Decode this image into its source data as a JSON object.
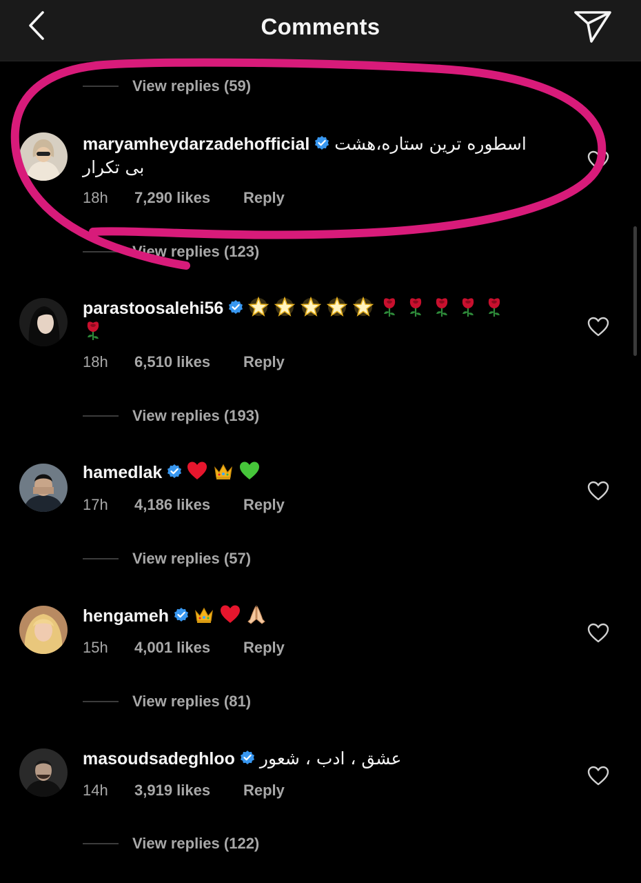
{
  "header": {
    "title": "Comments"
  },
  "top_replies": "View replies (59)",
  "comments": [
    {
      "username": "maryamheydarzadehofficial",
      "text_line1": "اسطوره ترین ستاره،هشت",
      "text_line2": "بی تکرار",
      "time": "18h",
      "likes": "7,290 likes",
      "reply": "Reply",
      "view_replies": "View replies (123)",
      "verified": true
    },
    {
      "username": "parastoosalehi56",
      "emojis": [
        "star",
        "star",
        "star",
        "star",
        "star",
        "rose",
        "rose",
        "rose",
        "rose",
        "rose",
        "rose"
      ],
      "time": "18h",
      "likes": "6,510 likes",
      "reply": "Reply",
      "view_replies": "View replies (193)",
      "verified": true
    },
    {
      "username": "hamedlak",
      "emojis": [
        "red-heart",
        "crown",
        "green-heart"
      ],
      "time": "17h",
      "likes": "4,186 likes",
      "reply": "Reply",
      "view_replies": "View replies (57)",
      "verified": true
    },
    {
      "username": "hengameh",
      "emojis": [
        "crown",
        "red-heart",
        "folded-hands"
      ],
      "time": "15h",
      "likes": "4,001 likes",
      "reply": "Reply",
      "view_replies": "View replies (81)",
      "verified": true
    },
    {
      "username": "masoudsadeghloo",
      "text_line1": "عشق ، ادب ، شعور",
      "time": "14h",
      "likes": "3,919 likes",
      "reply": "Reply",
      "view_replies": "View replies (122)",
      "verified": true
    }
  ],
  "colors": {
    "background": "#000000",
    "header_bg": "#1a1a1a",
    "muted_text": "#a8a8a8",
    "verified_blue": "#3897f0",
    "highlight_stroke": "#d81b7a"
  },
  "icons": [
    "back-chevron-icon",
    "send-direct-icon",
    "verified-badge-icon",
    "heart-outline-icon"
  ]
}
